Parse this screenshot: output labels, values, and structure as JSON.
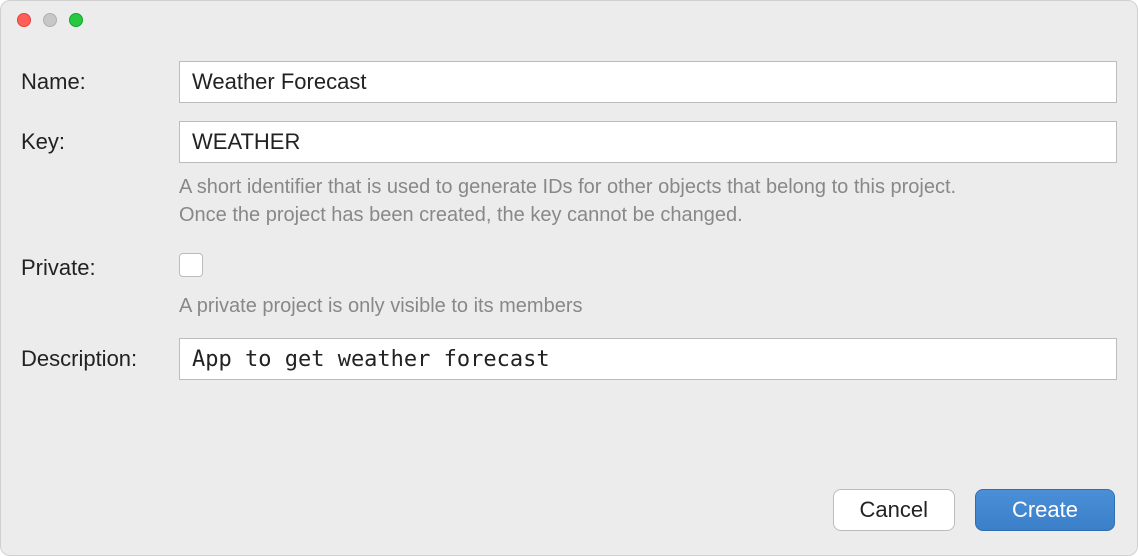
{
  "form": {
    "name": {
      "label": "Name:",
      "value": "Weather Forecast"
    },
    "key": {
      "label": "Key:",
      "value": "WEATHER",
      "help_line1": "A short identifier that is used to generate IDs for other objects that belong to this project.",
      "help_line2": "Once the project has been created, the key cannot be changed."
    },
    "private": {
      "label": "Private:",
      "help": "A private project is only visible to its members"
    },
    "description": {
      "label": "Description:",
      "value": "App to get weather forecast"
    }
  },
  "buttons": {
    "cancel": "Cancel",
    "create": "Create"
  }
}
